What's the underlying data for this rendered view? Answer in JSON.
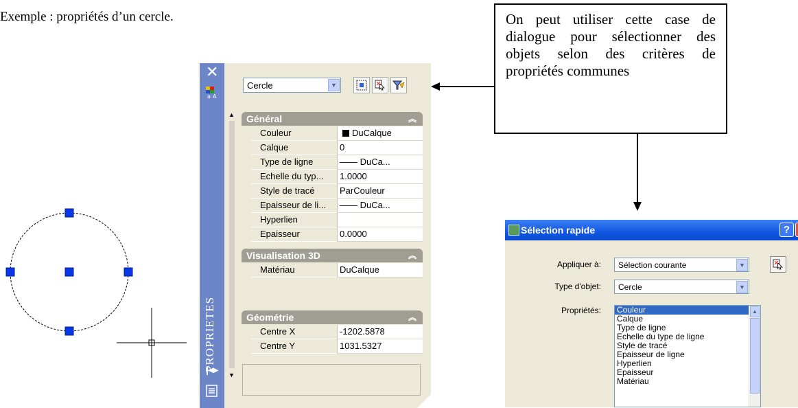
{
  "doc": {
    "caption": "Exemple : propriétés d’un cercle."
  },
  "callout": {
    "text": "On peut utiliser cette case de dialogue pour sélectionner des objets selon des critères de propriétés communes"
  },
  "palette": {
    "vertical_title": "PROPRIETES",
    "selected_object": "Cercle",
    "sections": {
      "general": {
        "title": "Général",
        "rows": [
          {
            "name": "Couleur",
            "value": "DuCalque"
          },
          {
            "name": "Calque",
            "value": "0"
          },
          {
            "name": "Type de ligne",
            "value": "—— DuCa..."
          },
          {
            "name": "Echelle du typ...",
            "value": "1.0000"
          },
          {
            "name": "Style de tracé",
            "value": "ParCouleur"
          },
          {
            "name": "Epaisseur de li...",
            "value": "—— DuCa..."
          },
          {
            "name": "Hyperlien",
            "value": ""
          },
          {
            "name": "Epaisseur",
            "value": "0.0000"
          }
        ]
      },
      "visualisation": {
        "title": "Visualisation 3D",
        "rows": [
          {
            "name": "Matériau",
            "value": "DuCalque"
          }
        ]
      },
      "geometrie": {
        "title": "Géométrie",
        "rows": [
          {
            "name": "Centre X",
            "value": "-1202.5878"
          },
          {
            "name": "Centre Y",
            "value": "1031.5327"
          }
        ]
      }
    },
    "icons": [
      "close-icon",
      "properties-icon",
      "quick-select-icon",
      "select-objects-icon",
      "toggle-pickadd-icon",
      "auto-hide-icon",
      "menu-icon"
    ]
  },
  "quick_select": {
    "title": "Sélection rapide",
    "help": "?",
    "close": "X",
    "apply_label": "Appliquer à:",
    "apply_value": "Sélection courante",
    "type_label": "Type d'objet:",
    "type_value": "Cercle",
    "props_label": "Propriétés:",
    "properties": [
      "Couleur",
      "Calque",
      "Type de ligne",
      "Echelle du type de ligne",
      "Style de tracé",
      "Epaisseur de ligne",
      "Hyperlien",
      "Epaisseur",
      "Matériau"
    ],
    "selected_property": "Couleur"
  }
}
